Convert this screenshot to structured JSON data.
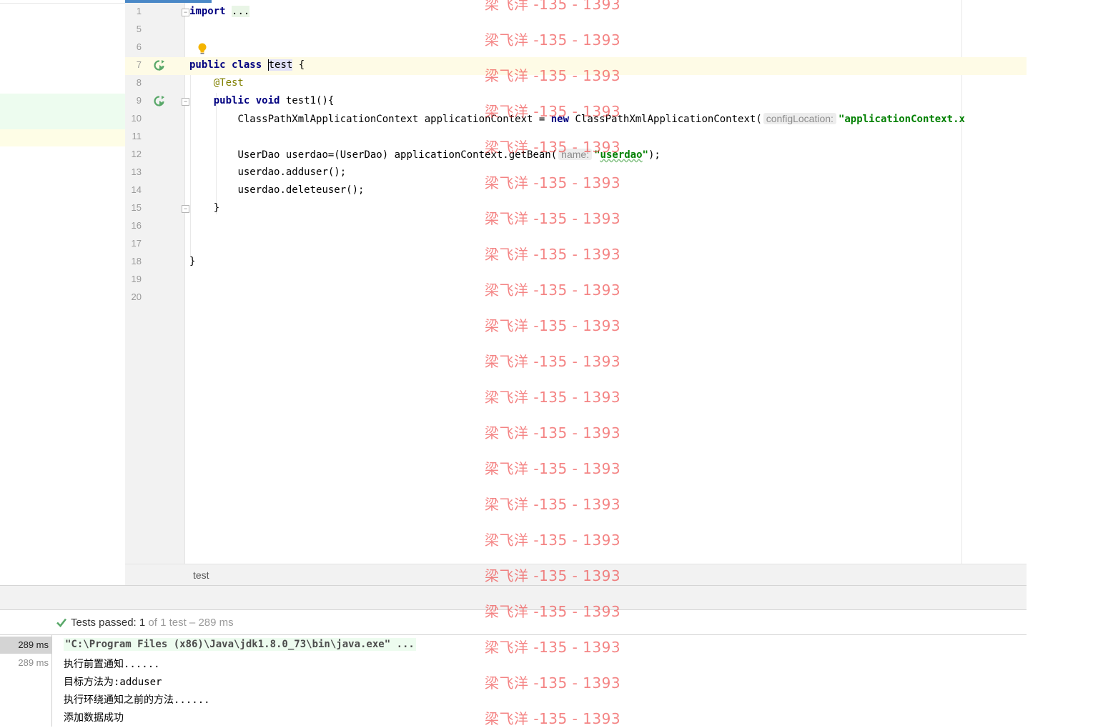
{
  "editor": {
    "class_name": "test",
    "lines": [
      {
        "num": "1"
      },
      {
        "num": "5"
      },
      {
        "num": "6"
      },
      {
        "num": "7"
      },
      {
        "num": "8"
      },
      {
        "num": "9"
      },
      {
        "num": "10"
      },
      {
        "num": "11"
      },
      {
        "num": "12"
      },
      {
        "num": "13"
      },
      {
        "num": "14"
      },
      {
        "num": "15"
      },
      {
        "num": "16"
      },
      {
        "num": "17"
      },
      {
        "num": "18"
      },
      {
        "num": "19"
      },
      {
        "num": "20"
      }
    ],
    "tokens": {
      "import_kw": "import",
      "import_fold": "...",
      "public": "public",
      "class": "class",
      "open_brace": "{",
      "annotation": "@Test",
      "void": "void",
      "method_sig": "test1(){",
      "l10_a": "ClassPathXmlApplicationContext applicationContext = ",
      "new": "new",
      "l10_b": " ClassPathXmlApplicationContext(",
      "hint_config": "configLocation:",
      "l10_str": "\"applicationContext.x",
      "l12_a": "UserDao userdao=(UserDao) applicationContext.getBean(",
      "hint_name": "name:",
      "l12_str_q1": "\"",
      "l12_str": "userdao",
      "l12_str_q2": "\"",
      "l12_end": ");",
      "l13": "userdao.adduser();",
      "l14": "userdao.deleteuser();",
      "method_close": "}",
      "class_close": "}"
    }
  },
  "breadcrumb": "test",
  "run": {
    "status_prefix": "Tests passed: ",
    "passed": "1",
    "status_suffix": " of 1 test – 289 ms",
    "durations": [
      "289 ms",
      "289 ms"
    ],
    "console_lines": [
      "\"C:\\Program Files (x86)\\Java\\jdk1.8.0_73\\bin\\java.exe\" ...",
      "执行前置通知......",
      "目标方法为:adduser",
      "执行环绕通知之前的方法......",
      "添加数据成功"
    ]
  },
  "watermark": "梁飞洋 -135 - 1393",
  "colors": {
    "accent": "#4a88c7",
    "keyword": "#000080",
    "string": "#008000",
    "annotation": "#808000",
    "watermark": "#ee3a3a",
    "pass": "#59a869"
  }
}
